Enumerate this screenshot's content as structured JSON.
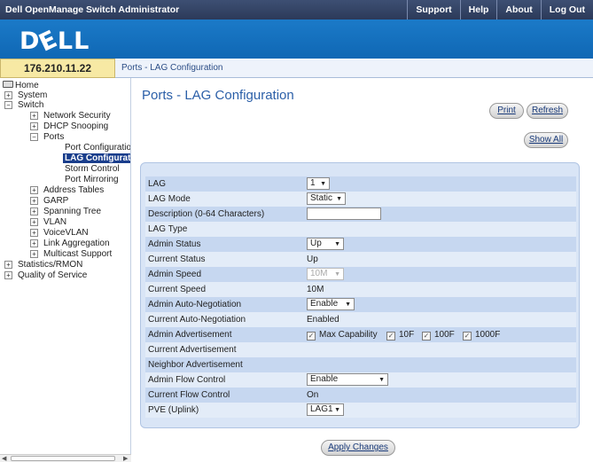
{
  "header": {
    "app_title": "Dell OpenManage Switch Administrator",
    "nav": [
      "Support",
      "Help",
      "About",
      "Log Out"
    ],
    "logo": "DELL"
  },
  "ip": "176.210.11.22",
  "breadcrumb": "Ports - LAG Configuration",
  "tree": {
    "home": "Home",
    "system": "System",
    "switch": "Switch",
    "network_security": "Network Security",
    "dhcp_snooping": "DHCP Snooping",
    "ports": "Ports",
    "port_configuration": "Port Configuration",
    "lag_configuration": "LAG Configuration",
    "storm_control": "Storm Control",
    "port_mirroring": "Port Mirroring",
    "address_tables": "Address Tables",
    "garp": "GARP",
    "spanning_tree": "Spanning Tree",
    "vlan": "VLAN",
    "voicevlan": "VoiceVLAN",
    "link_aggregation": "Link Aggregation",
    "multicast_support": "Multicast Support",
    "statistics_rmon": "Statistics/RMON",
    "quality_of_service": "Quality of Service"
  },
  "page_title": "Ports - LAG Configuration",
  "buttons": {
    "print": "Print",
    "refresh": "Refresh",
    "show_all": "Show All",
    "apply": "Apply Changes"
  },
  "form": {
    "lag": {
      "label": "LAG",
      "value": "1"
    },
    "lag_mode": {
      "label": "LAG Mode",
      "value": "Static"
    },
    "description": {
      "label": "Description (0-64 Characters)",
      "value": ""
    },
    "lag_type": {
      "label": "LAG Type",
      "value": ""
    },
    "admin_status": {
      "label": "Admin Status",
      "value": "Up"
    },
    "current_status": {
      "label": "Current Status",
      "value": "Up"
    },
    "admin_speed": {
      "label": "Admin Speed",
      "value": "10M"
    },
    "current_speed": {
      "label": "Current Speed",
      "value": "10M"
    },
    "admin_autoneg": {
      "label": "Admin Auto-Negotiation",
      "value": "Enable"
    },
    "current_autoneg": {
      "label": "Current Auto-Negotiation",
      "value": "Enabled"
    },
    "admin_adv": {
      "label": "Admin Advertisement",
      "opt_max": "Max Capability",
      "opt_10f": "10F",
      "opt_100f": "100F",
      "opt_1000f": "1000F"
    },
    "current_adv": {
      "label": "Current Advertisement",
      "value": ""
    },
    "neighbor_adv": {
      "label": "Neighbor Advertisement",
      "value": ""
    },
    "admin_flow": {
      "label": "Admin Flow Control",
      "value": "Enable"
    },
    "current_flow": {
      "label": "Current Flow Control",
      "value": "On"
    },
    "pve": {
      "label": "PVE (Uplink)",
      "value": "LAG1"
    }
  },
  "icons": {
    "dropdown": "chevron-down-icon",
    "check": "checkmark-icon",
    "home": "home-icon"
  },
  "colors": {
    "topbar": "#2c3a59",
    "logo_band": "#1170bd",
    "panel": "#d9e5f6",
    "selected_tree": "#1a3e8c",
    "title": "#2b5fa8"
  }
}
